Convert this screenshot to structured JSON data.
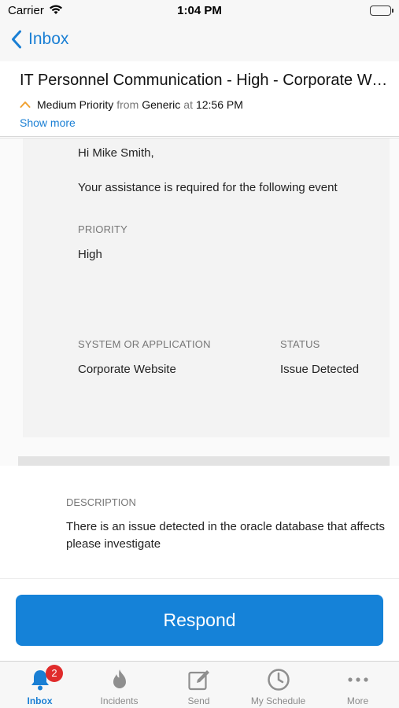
{
  "status_bar": {
    "carrier": "Carrier",
    "time": "1:04 PM"
  },
  "nav": {
    "back_label": "Inbox"
  },
  "header": {
    "subject": "IT Personnel Communication - High - Corporate Website - Issue Detected",
    "priority": "Medium Priority",
    "from_word": "from",
    "sender": "Generic",
    "at_word": "at",
    "time": "12:56 PM",
    "show_more": "Show more"
  },
  "message": {
    "greeting": "Hi Mike Smith,",
    "intro": "Your assistance is required for the following event",
    "priority_label": "PRIORITY",
    "priority_value": "High",
    "system_label": "SYSTEM OR APPLICATION",
    "system_value": "Corporate Website",
    "status_label": "STATUS",
    "status_value": "Issue Detected",
    "description_label": "DESCRIPTION",
    "description_text": "There is an issue detected in the oracle database that affects\nplease investigate"
  },
  "actions": {
    "respond_label": "Respond"
  },
  "tabs": [
    {
      "label": "Inbox",
      "icon": "bell-icon",
      "badge": "2",
      "active": true
    },
    {
      "label": "Incidents",
      "icon": "flame-icon"
    },
    {
      "label": "Send",
      "icon": "compose-icon"
    },
    {
      "label": "My Schedule",
      "icon": "clock-icon"
    },
    {
      "label": "More",
      "icon": "ellipsis-icon"
    }
  ],
  "colors": {
    "accent": "#1a7fd4",
    "button": "#1582d8",
    "badge": "#e02b2b",
    "priority_caret": "#f0a030"
  }
}
